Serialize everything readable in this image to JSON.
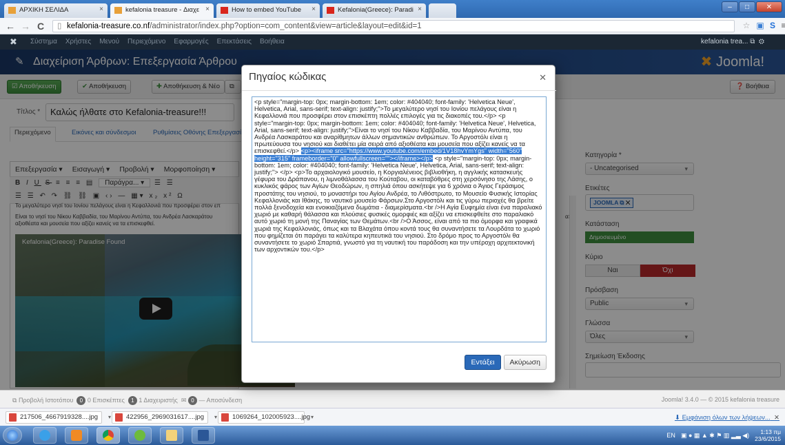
{
  "browser": {
    "tabs": [
      {
        "label": "ΑΡΧΙΚΗ ΣΕΛΙΔΑ",
        "active": false
      },
      {
        "label": "kefalonia treasure - Διαχε",
        "active": true
      },
      {
        "label": "How to embed YouTube",
        "active": false
      },
      {
        "label": "Kefalonia(Greece): Paradi",
        "active": false
      }
    ],
    "url_host": "kefalonia-treasure.co.nf",
    "url_path": "/administrator/index.php?option=com_content&view=article&layout=edit&id=1"
  },
  "joomla_top": {
    "menu": [
      "Σύστημα",
      "Χρήστες",
      "Μενού",
      "Περιεχόμενο",
      "Εφαρμογές",
      "Επεκτάσεις",
      "Βοήθεια"
    ],
    "site_link": "kefalonia trea..."
  },
  "header": {
    "title": "Διαχείριση Άρθρων: Επεξεργασία Άρθρου",
    "brand": "Joomla!"
  },
  "toolbar": {
    "save": "Αποθήκευση",
    "save_close": "Αποθήκευση",
    "save_new": "Αποθήκευση & Νέο",
    "help": "Βοήθεια"
  },
  "article": {
    "title_label": "Τίτλος *",
    "title_value": "Καλώς ήλθατε στο Kefalonia-treasure!!!",
    "tabs": [
      "Περιεχόμενο",
      "Εικόνες και σύνδεσμοι",
      "Ρυθμίσεις Οθόνης Επεξεργασία"
    ],
    "editor_menu": [
      "Επεξεργασία",
      "Εισαγωγή",
      "Προβολή",
      "Μορφοποίηση"
    ],
    "format_select": "Παράγρα...",
    "editor_line1": "Το μεγαλύτερο νησί του Ιονίου πελάγους είναι η Κεφαλλονιά που προσφέρει στον επ",
    "editor_line2": "Είναι το νησί του Νίκου Καββαδία, του Μαρίνου Αντύπα, του Ανδρέα Λασκαράτου",
    "editor_line3": "αξιοθέατα και μουσεία που αξίζει κανείς να τα επισκεφθεί.",
    "editor_line2_tail": "από",
    "video_title": "Kefalonia(Greece): Paradise Found"
  },
  "sidebar": {
    "category_label": "Κατηγορία *",
    "category_value": "- Uncategorised",
    "tags_label": "Ετικέτες",
    "tag": "JOOMLA",
    "status_label": "Κατάσταση",
    "status_value": "Δημοσιευμένο",
    "featured_label": "Κύριο",
    "yes": "Ναι",
    "no": "Όχι",
    "access_label": "Πρόσβαση",
    "access_value": "Public",
    "language_label": "Γλώσσα",
    "language_value": "Όλες",
    "version_label": "Σημείωση Έκδοσης"
  },
  "footer": {
    "view_site": "Προβολή Ιστοτόπου",
    "visitors": "0 Επισκέπτες",
    "admins": "1 Διαχειριστής",
    "logout": "Αποσύνδεση",
    "visitors_count": "0",
    "admins_count": "1",
    "msg_count": "0",
    "version": "Joomla! 3.4.0 — © 2015 kefalonia treasure"
  },
  "downloads": {
    "items": [
      "217506_4667919328....jpg",
      "422956_2969031617....jpg",
      "1069264_102005923....jpg"
    ],
    "show_all": "Εμφάνιση όλων των λήψεων..."
  },
  "taskbar": {
    "lang": "EN",
    "time": "1:13 πμ",
    "date": "23/6/2015"
  },
  "modal": {
    "title": "Πηγαίος κώδικας",
    "code_before": "<p style=\"margin-top: 0px; margin-bottom: 1em; color: #404040; font-family: 'Helvetica Neue', Helvetica, Arial, sans-serif; text-align: justify;\">Το μεγαλύτερο νησί του Ιονίου πελάγους είναι η Κεφαλλονιά που προσφέρει στον επισκέπτη πολλές επιλογές για τις διακοπές του.</p> <p style=\"margin-top: 0px; margin-bottom: 1em; color: #404040; font-family: 'Helvetica Neue', Helvetica, Arial, sans-serif; text-align: justify;\">Είναι το νησί του Νίκου Καββαδία, του Μαρίνου Αντύπα, του Ανδρέα Λασκαράτου και αναρίθμητων άλλων σημαντικών ανθρώπων. Το Αργοστόλι είναι η πρωτεύουσα του νησιού και διαθέτει μία σειρά από αξιοθέατα και μουσεία που αξίζει κανείς να τα επισκεφθεί.</p> ",
    "code_selected": "<p><iframe src=\"https://www.youtube.com/embed/1V18hvYmYgs\" width=\"560\" height=\"315\" frameborder=\"0\" allowfullscreen=\"\"></iframe></p>",
    "code_after": " <p style=\"margin-top: 0px; margin-bottom: 1em; color: #404040; font-family: 'Helvetica Neue', Helvetica, Arial, sans-serif; text-align: justify;\"> </p> <p>Το αρχαιολογικό μουσείο, η Κοργιαλένειος βιβλιοθήκη, η αγγλικής κατασκευής γέφυρα του Δράπανου, η λιμνοθάλασσα του Κούταβου, οι καταβόθρες στη χερσόνησο της Λάσης, ο κυκλικός φάρος των Αγίων Θεοδώρων, η σπηλιά όπου ασκήτεψε για 6 χρόνια ο Άγιος Γεράσιμος προστάτης του νησιού, το μοναστήρι του Αγίου Ανδρέα, το Λιθόστρωτο, το Μουσείο Φυσικής Ιστορίας Κεφαλλονιάς και Ιθάκης, το ναυτικό μουσείο Φάρσων.Στο Αργοστόλι και τις γύρω περιοχές θα βρείτε πολλά ξενοδοχεία και ενοικιαζόμενα δωμάτια - διαμερίσματα.<br />Η Αγία Ευφημία είναι ένα παραλιακό χωριό με καθαρή θάλασσα και πλούσιες φυσικές ομορφιές και αξίζει να επισκεφθείτε στο παραλιακό αυτό χωριό τη μονή της Παναγίας των Θεμάτων.<br />Ο Άσσος, είναι από τα πιο όμορφα και γραφικά χωριά της Κεφαλλονιάς, όπως και τα Βλαχάτα όπου κοντά τους θα συναντήσετε τα Λουρδάτα το χωριό που φημίζεται ότι παράγει τα καλύτερα κηπευτικά του νησιού. Στο δρόμο προς το Αργοστόλι θα συναντήσετε το χωριό Σπαρτιά, γνωστό για τη ναυτική του παράδοση και την υπέροχη αρχιτεκτονική των αρχοντικών του.</p>",
    "ok": "Εντάξει",
    "cancel": "Ακύρωση"
  }
}
